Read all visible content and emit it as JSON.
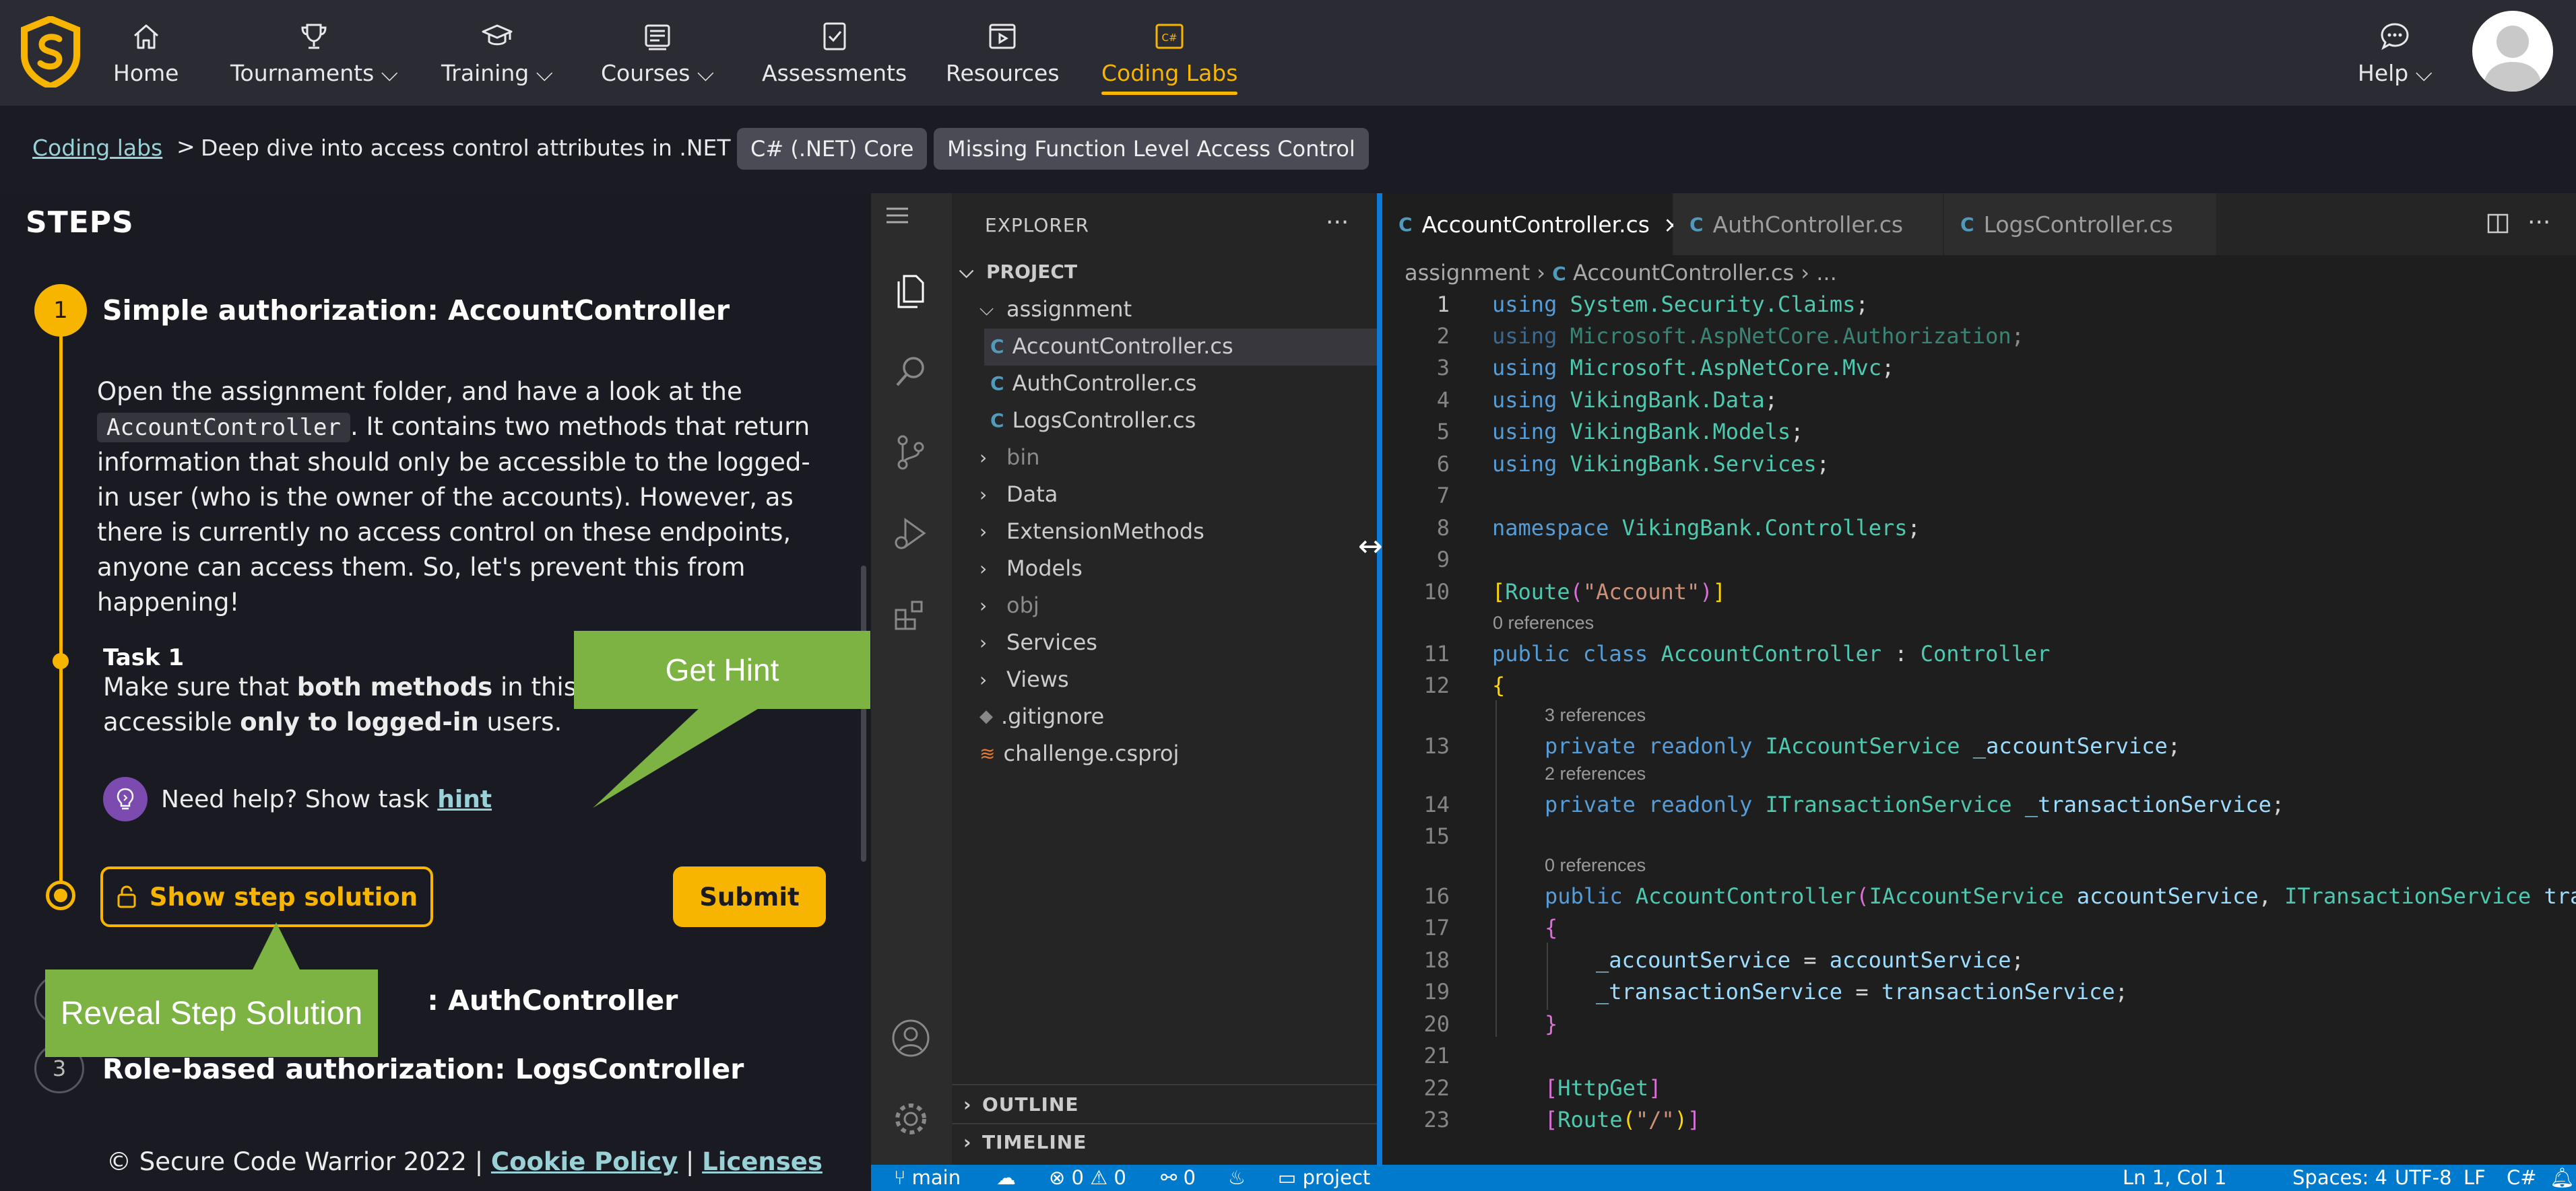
{
  "nav": {
    "items": [
      {
        "label": "Home",
        "icon": "home-icon"
      },
      {
        "label": "Tournaments",
        "icon": "trophy-icon"
      },
      {
        "label": "Training",
        "icon": "graduation-cap-icon"
      },
      {
        "label": "Courses",
        "icon": "courses-icon"
      },
      {
        "label": "Assessments",
        "icon": "assessment-icon"
      },
      {
        "label": "Resources",
        "icon": "resources-icon"
      },
      {
        "label": "Coding Labs",
        "icon": "coding-labs-icon"
      }
    ],
    "help": "Help",
    "accent": "#f7b500"
  },
  "breadcrumb": {
    "link": "Coding labs",
    "sep": ">",
    "title": "Deep dive into access control attributes in .NET Core",
    "tags": [
      "C# (.NET) Core",
      "Missing Function Level Access Control"
    ]
  },
  "steps": {
    "heading": "STEPS",
    "step1": {
      "number": "1",
      "title": "Simple authorization: AccountController",
      "body_1": "Open the assignment folder, and have a look at the",
      "body_code": "AccountController",
      "body_2": ". It contains two methods that return information that should only be accessible to the logged-in user (who is the owner of the accounts). However, as there is currently no access control on these endpoints, anyone can access them. So, let's prevent this from happening!",
      "task_title": "Task 1",
      "task_1": "Make sure that ",
      "task_b1": "both methods",
      "task_2": " in this co",
      "task_3": "accessible ",
      "task_b2": "only to logged-in",
      "task_4": " users.",
      "hint_text": "Need help? Show task",
      "hint_link": "hint",
      "solution_btn": "Show step solution",
      "submit_btn": "Submit"
    },
    "step2": {
      "number": "2",
      "title": ": AuthController"
    },
    "step3": {
      "number": "3",
      "title": "Role-based authorization: LogsController"
    }
  },
  "callouts": {
    "hint": "Get Hint",
    "solution": "Reveal Step Solution"
  },
  "footer": {
    "text": "© Secure Code Warrior 2022 |",
    "cookie": "Cookie Policy",
    "sep": "|",
    "licenses": "Licenses"
  },
  "explorer": {
    "title": "EXPLORER",
    "more": "···",
    "project": "PROJECT",
    "folder": "assignment",
    "files": [
      "AccountController.cs",
      "AuthController.cs",
      "LogsController.cs"
    ],
    "folders": [
      "bin",
      "Data",
      "ExtensionMethods",
      "Models",
      "obj",
      "Services",
      "Views"
    ],
    "gitignore": ".gitignore",
    "csproj": "challenge.csproj",
    "outline": "OUTLINE",
    "timeline": "TIMELINE"
  },
  "editor": {
    "tabs": [
      "AccountController.cs",
      "AuthController.cs",
      "LogsController.cs"
    ],
    "close": "×",
    "breadcrumb_folder": "assignment",
    "breadcrumb_file": "AccountController.cs",
    "breadcrumb_more": "...",
    "refs0": "0 references",
    "refs3": "3 references",
    "refs2": "2 references",
    "line_numbers": [
      "1",
      "2",
      "3",
      "4",
      "5",
      "6",
      "7",
      "8",
      "9",
      "10",
      "11",
      "12",
      "13",
      "14",
      "15",
      "16",
      "17",
      "18",
      "19",
      "20",
      "21",
      "22",
      "23"
    ]
  },
  "status": {
    "branch": "main",
    "problems": "0",
    "warnings": "0",
    "ports": "0",
    "folder": "project",
    "position": "Ln 1, Col 1",
    "spaces": "Spaces: 4",
    "encoding": "UTF-8",
    "eol": "LF",
    "language": "C#"
  }
}
